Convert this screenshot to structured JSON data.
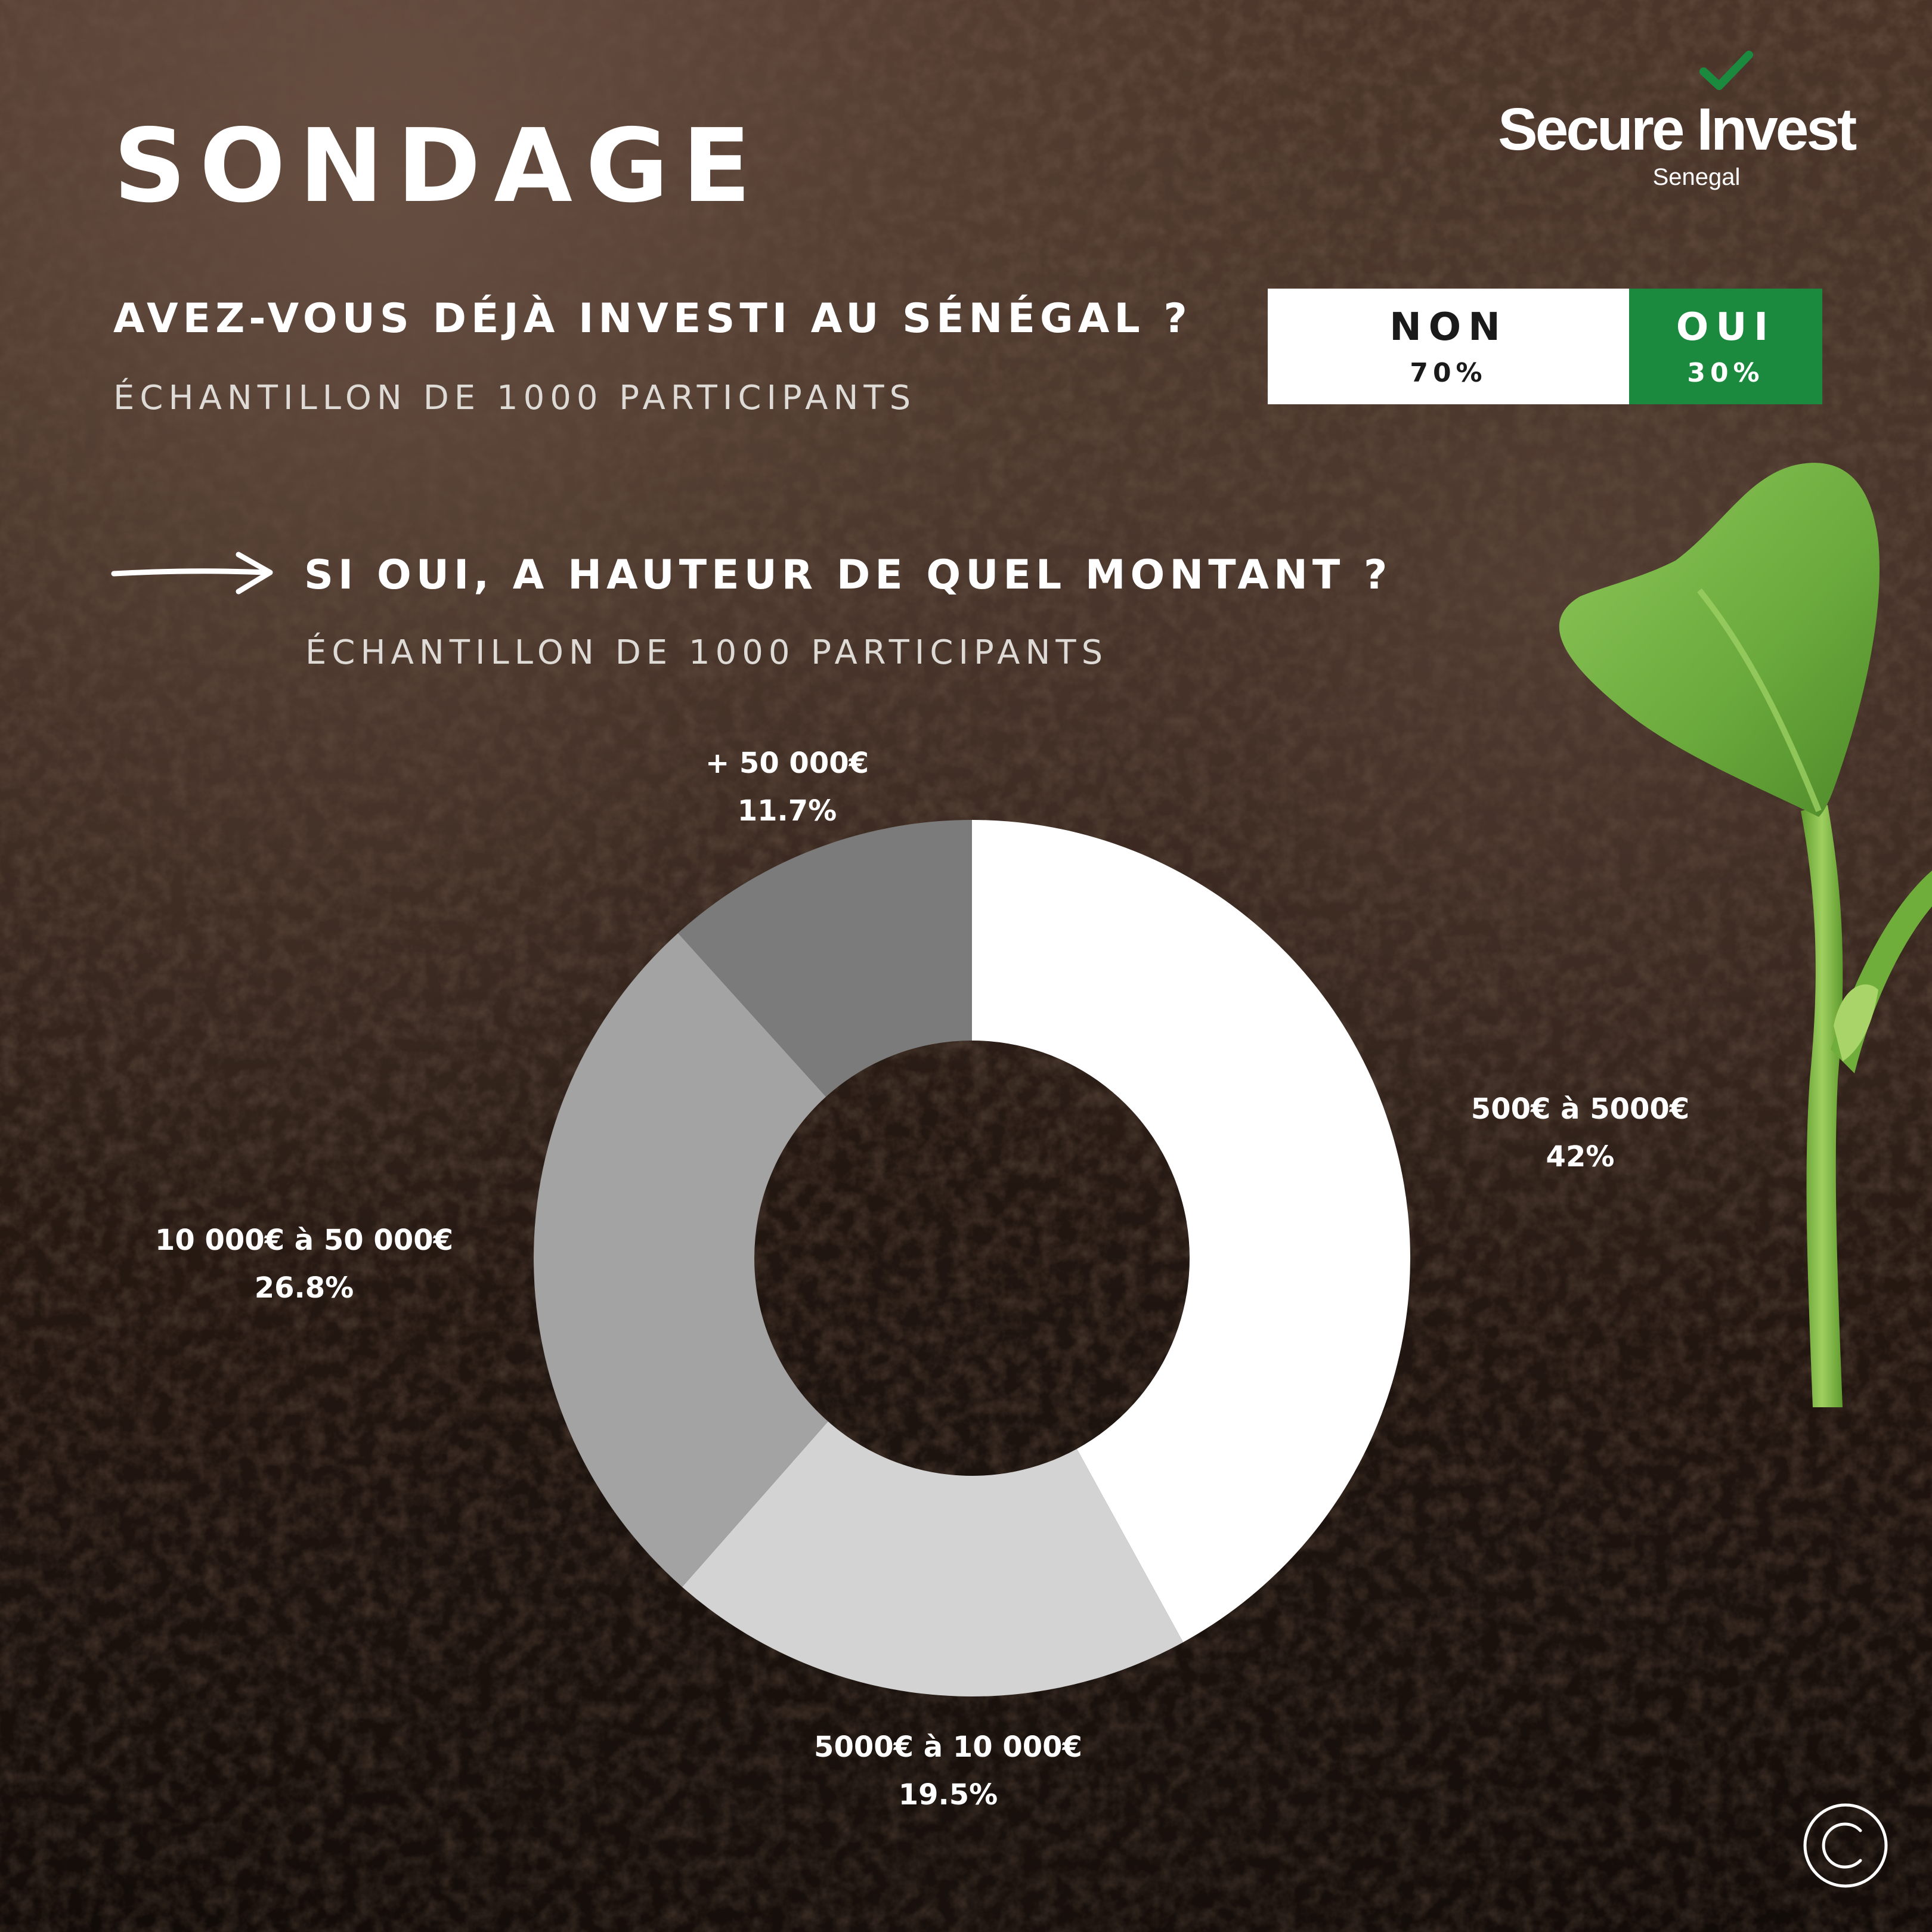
{
  "header": {
    "title": "SONDAGE",
    "logo_name": "Secure Invest",
    "logo_sub": "Senegal"
  },
  "question1": {
    "text": "AVEZ-VOUS DÉJÀ INVESTI AU SÉNÉGAL ?",
    "sample": "ÉCHANTILLON DE 1000 PARTICIPANTS",
    "no_label": "NON",
    "no_value": "70%",
    "yes_label": "OUI",
    "yes_value": "30%"
  },
  "question2": {
    "text": "SI OUI, A HAUTEUR DE QUEL MONTANT ?",
    "sample": "ÉCHANTILLON DE 1000 PARTICIPANTS"
  },
  "chart_data": [
    {
      "type": "bar",
      "orientation": "horizontal-stacked",
      "categories": [
        "NON",
        "OUI"
      ],
      "values": [
        70,
        30
      ],
      "unit": "%",
      "colors": [
        "#ffffff",
        "#1b8a3f"
      ]
    },
    {
      "type": "pie",
      "variant": "donut",
      "categories": [
        "500€ à 5000€",
        "5000€ à 10 000€",
        "10 000€ à 50 000€",
        "+ 50 000€"
      ],
      "values": [
        42,
        19.5,
        26.8,
        11.7
      ],
      "labels": [
        "42%",
        "19.5%",
        "26.8%",
        "11.7%"
      ],
      "unit": "%",
      "colors": [
        "#ffffff",
        "#d3d3d3",
        "#a3a3a3",
        "#7b7b7b"
      ]
    }
  ],
  "colors": {
    "accent_green": "#1b8a3f",
    "logo_check": "#1b8a3f"
  },
  "icons": [
    "arrow-right-icon",
    "checkmark-icon",
    "copyright-icon",
    "seedling-image"
  ]
}
